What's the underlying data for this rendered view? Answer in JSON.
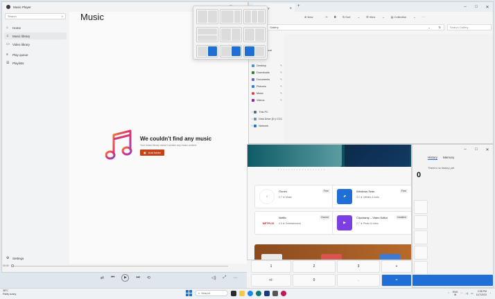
{
  "music": {
    "window_title": "Music Player",
    "search_placeholder": "Search",
    "nav": [
      {
        "label": "Home",
        "icon": "home-icon"
      },
      {
        "label": "Music library",
        "icon": "music-note-icon"
      },
      {
        "label": "Video library",
        "icon": "video-icon"
      },
      {
        "label": "Play queue",
        "icon": "queue-icon"
      },
      {
        "label": "Playlists",
        "icon": "playlist-icon"
      }
    ],
    "settings_label": "Settings",
    "page_title": "Music",
    "empty_title": "We couldn't find any music",
    "empty_desc": "Your music library doesn't contain any music content.",
    "add_folder_label": "Add folder",
    "time_elapsed": "00:00"
  },
  "explorer": {
    "tab_title": "Gallery",
    "toolbar": [
      "New",
      "Sort",
      "View",
      "Collection"
    ],
    "address": "Gallery",
    "search_placeholder": "Search Gallery",
    "nav": [
      {
        "label": "Desktop",
        "color": "#4a90d9"
      },
      {
        "label": "Downloads",
        "color": "#2e7d32"
      },
      {
        "label": "Documents",
        "color": "#5c6bc0"
      },
      {
        "label": "Pictures",
        "color": "#1e88e5"
      },
      {
        "label": "Music",
        "color": "#e53935"
      },
      {
        "label": "Videos",
        "color": "#8e24aa"
      },
      {
        "label": "This PC",
        "color": "#546e7a"
      },
      {
        "label": "Disk Drive (D:) CCC",
        "color": "#78909c"
      },
      {
        "label": "Network",
        "color": "#1976d2"
      }
    ],
    "found_label": "Found"
  },
  "store": {
    "cards": [
      {
        "name": "iTunes",
        "meta": "2.7 ★   Music",
        "badge": "Free",
        "logo": "♪",
        "logo_bg": "#ffffff",
        "logo_color": "#e0457b"
      },
      {
        "name": "Windows Scan",
        "meta": "3.2 ★   Utilities & tools",
        "badge": "Free",
        "logo": "⬈",
        "logo_bg": "#1f6fd6",
        "logo_color": "#ffffff"
      },
      {
        "name": "Netflix",
        "meta": "4.3 ★   Entertainment",
        "badge": "Owned",
        "logo": "NETFLIX",
        "logo_bg": "#ffffff",
        "logo_color": "#e50914"
      },
      {
        "name": "Clipchamp – Video Editor",
        "meta": "2.7 ★   Photo & video",
        "badge": "Installed",
        "logo": "▶",
        "logo_bg": "#7b3fe4",
        "logo_color": "#ffffff"
      }
    ]
  },
  "calc": {
    "tabs": [
      "History",
      "Memory"
    ],
    "no_history": "There's no history yet",
    "display": "0",
    "keys": [
      "1",
      "2",
      "3",
      "+",
      "+/-",
      "0",
      ".",
      "="
    ]
  },
  "taskbar": {
    "weather_temp": "38°C",
    "weather_desc": "Partly sunny",
    "search_placeholder": "Search",
    "lang": "ENG",
    "region": "IN",
    "time": "2:38 PM",
    "date": "11/7/2023"
  }
}
